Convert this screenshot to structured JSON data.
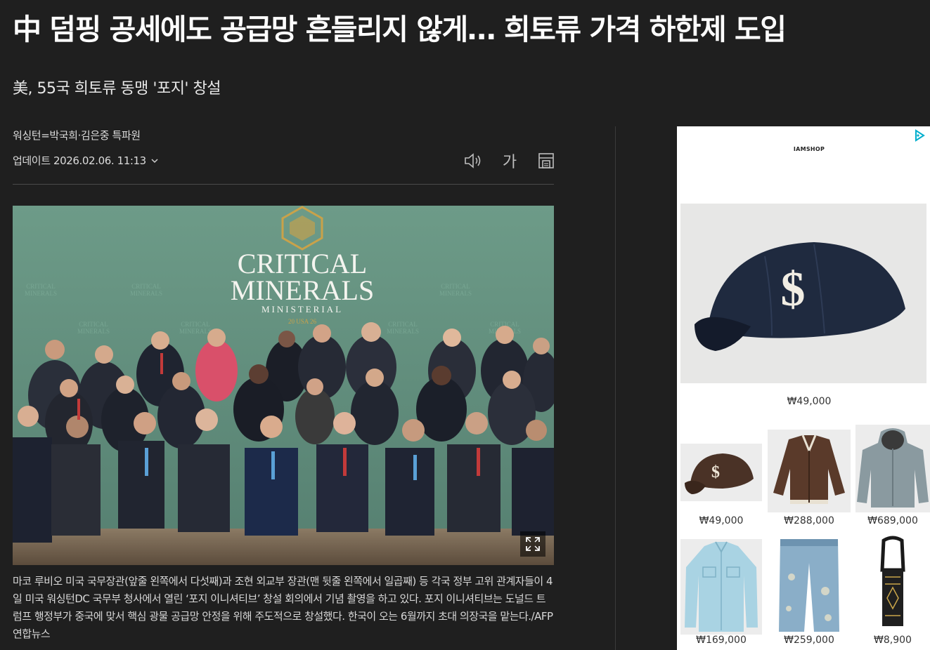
{
  "article": {
    "headline": "中 덤핑 공세에도 공급망 흔들리지 않게… 희토류 가격 하한제 도입",
    "subheadline": "美, 55국 희토류 동맹 '포지' 창설",
    "byline": "워싱턴=박국희·김은중 특파원",
    "updated": "업데이트 2026.02.06. 11:13",
    "tools": {
      "font_label": "가"
    },
    "photo": {
      "logo_line1": "CRITICAL",
      "logo_line2": "MINERALS",
      "logo_line3": "MINISTERIAL",
      "logo_line4": "20 USA 26"
    },
    "caption": "마코 루비오 미국 국무장관(앞줄 왼쪽에서 다섯째)과 조현 외교부 장관(맨 뒷줄 왼쪽에서 일곱째) 등 각국 정부 고위 관계자들이 4일 미국 워싱턴DC 국무부 청사에서 열린 ‘포지 이니셔티브’ 창설 회의에서 기념 촬영을 하고 있다. 포지 이니셔티브는 도널드 트럼프 행정부가 중국에 맞서 핵심 광물 공급망 안정을 위해 주도적으로 창설했다. 한국이 오는 6월까지 초대 의장국을 맡는다./AFP 연합뉴스"
  },
  "ad": {
    "brand": "IAMSHOP",
    "main_product": {
      "icon": "navy-baseball-cap",
      "price": "₩49,000"
    },
    "products": [
      {
        "icon": "brown-baseball-cap",
        "price": "₩49,000"
      },
      {
        "icon": "brown-varsity-jacket",
        "price": "₩288,000"
      },
      {
        "icon": "grey-hooded-parka",
        "price": "₩689,000"
      },
      {
        "icon": "light-blue-shirt",
        "price": "₩169,000"
      },
      {
        "icon": "distressed-jeans",
        "price": "₩259,000"
      },
      {
        "icon": "carabiner-keyring",
        "price": "₩8,900"
      }
    ]
  },
  "colors": {
    "background": "#1f1f1f",
    "text": "#ffffff",
    "ad_accent": "#00aecd"
  }
}
